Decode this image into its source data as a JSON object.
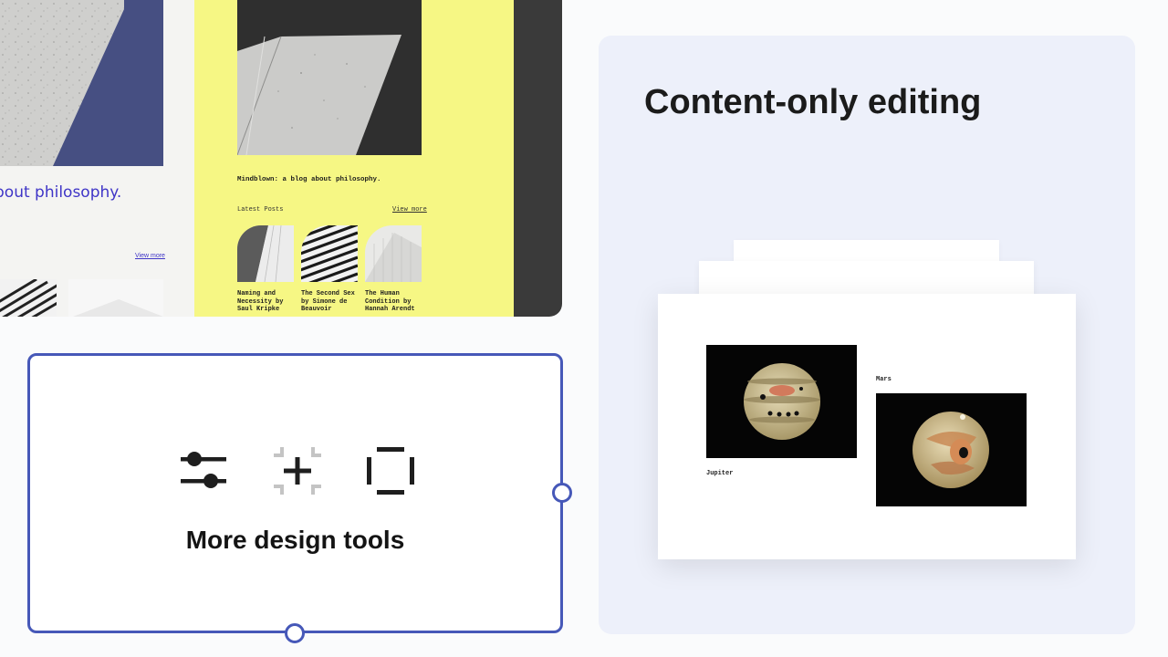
{
  "preview": {
    "site_a": {
      "tagline": "bout philosophy.",
      "view_more": "View more"
    },
    "site_b": {
      "blurb": "Mindblown: a blog about philosophy.",
      "latest_label": "Latest Posts",
      "view_more": "View more",
      "posts": [
        {
          "title": "Naming and Necessity by Saul Kripke"
        },
        {
          "title": "The Second Sex by Simone de Beauvoir"
        },
        {
          "title": "The Human Condition by Hannah Arendt"
        }
      ]
    }
  },
  "tools_card": {
    "title": "More design tools",
    "icons": [
      "sliders-icon",
      "spacing-icon",
      "dimensions-icon"
    ]
  },
  "content_card": {
    "title": "Content-only editing",
    "images": [
      {
        "caption": "Jupiter",
        "icon": "jupiter-image"
      },
      {
        "caption": "Mars",
        "icon": "mars-image"
      }
    ]
  },
  "colors": {
    "accent": "#4658b8",
    "site_b_bg": "#f6f784",
    "site_a_link": "#3f35c7",
    "card_bg": "#edf0fa"
  }
}
